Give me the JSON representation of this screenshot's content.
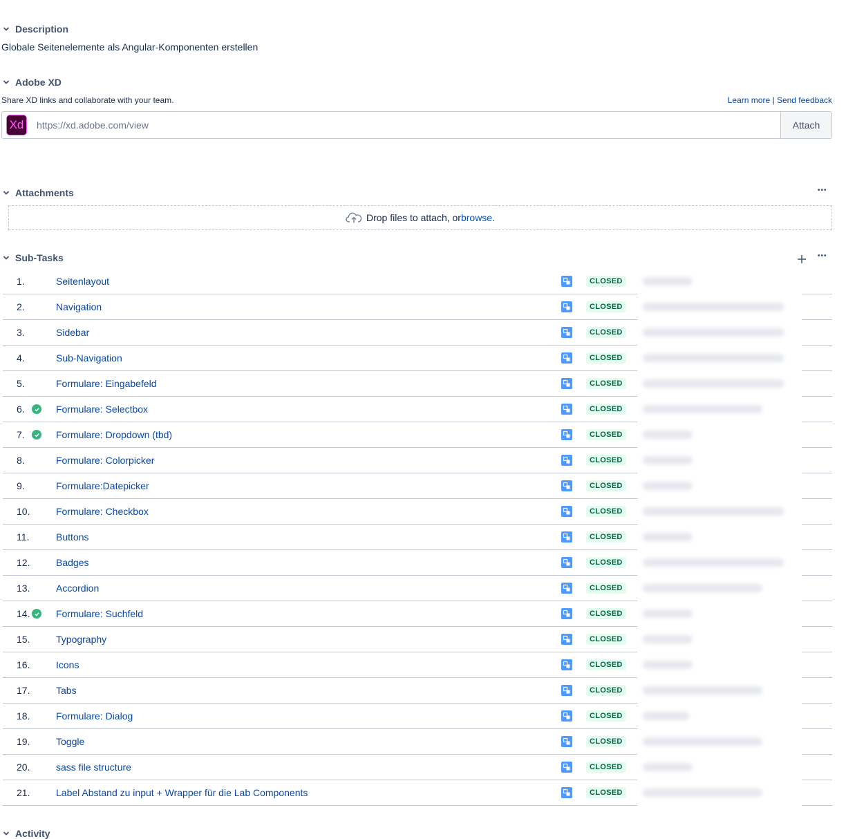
{
  "description": {
    "title": "Description",
    "text": "Globale Seitenelemente als Angular-Komponenten erstellen"
  },
  "adobe_xd": {
    "title": "Adobe XD",
    "note": "Share XD links and collaborate with your team.",
    "learn_more": "Learn more",
    "separator": "|",
    "send_feedback": "Send feedback",
    "logo_text": "Xd",
    "placeholder": "https://xd.adobe.com/view",
    "attach_label": "Attach"
  },
  "attachments": {
    "title": "Attachments",
    "more": "•••",
    "drop_text": "Drop files to attach, or ",
    "browse": "browse",
    "drop_suffix": "."
  },
  "subtasks": {
    "title": "Sub-Tasks",
    "more": "•••",
    "items": [
      {
        "num": "1.",
        "summary": "Seitenlayout",
        "status": "CLOSED",
        "check": false,
        "assignee_width": 0.3
      },
      {
        "num": "2.",
        "summary": "Navigation",
        "status": "CLOSED",
        "check": false,
        "assignee_width": 0.85
      },
      {
        "num": "3.",
        "summary": "Sidebar",
        "status": "CLOSED",
        "check": false,
        "assignee_width": 0.85
      },
      {
        "num": "4.",
        "summary": "Sub-Navigation",
        "status": "CLOSED",
        "check": false,
        "assignee_width": 0.85
      },
      {
        "num": "5.",
        "summary": "Formulare: Eingabefeld",
        "status": "CLOSED",
        "check": false,
        "assignee_width": 0.85
      },
      {
        "num": "6.",
        "summary": "Formulare: Selectbox",
        "status": "CLOSED",
        "check": true,
        "assignee_width": 0.72
      },
      {
        "num": "7.",
        "summary": "Formulare: Dropdown (tbd)",
        "status": "CLOSED",
        "check": true,
        "assignee_width": 0.3
      },
      {
        "num": "8.",
        "summary": "Formulare: Colorpicker",
        "status": "CLOSED",
        "check": false,
        "assignee_width": 0.3
      },
      {
        "num": "9.",
        "summary": "Formulare:Datepicker",
        "status": "CLOSED",
        "check": false,
        "assignee_width": 0.3
      },
      {
        "num": "10.",
        "summary": "Formulare: Checkbox",
        "status": "CLOSED",
        "check": false,
        "assignee_width": 0.85
      },
      {
        "num": "11.",
        "summary": "Buttons",
        "status": "CLOSED",
        "check": false,
        "assignee_width": 0.3
      },
      {
        "num": "12.",
        "summary": "Badges",
        "status": "CLOSED",
        "check": false,
        "assignee_width": 0.85
      },
      {
        "num": "13.",
        "summary": "Accordion",
        "status": "CLOSED",
        "check": false,
        "assignee_width": 0.72
      },
      {
        "num": "14.",
        "summary": "Formulare: Suchfeld",
        "status": "CLOSED",
        "check": true,
        "assignee_width": 0.3
      },
      {
        "num": "15.",
        "summary": "Typography",
        "status": "CLOSED",
        "check": false,
        "assignee_width": 0.3
      },
      {
        "num": "16.",
        "summary": "Icons",
        "status": "CLOSED",
        "check": false,
        "assignee_width": 0.3
      },
      {
        "num": "17.",
        "summary": "Tabs",
        "status": "CLOSED",
        "check": false,
        "assignee_width": 0.72
      },
      {
        "num": "18.",
        "summary": "Formulare: Dialog",
        "status": "CLOSED",
        "check": false,
        "assignee_width": 0.28
      },
      {
        "num": "19.",
        "summary": "Toggle",
        "status": "CLOSED",
        "check": false,
        "assignee_width": 0.72
      },
      {
        "num": "20.",
        "summary": "sass file structure",
        "status": "CLOSED",
        "check": false,
        "assignee_width": 0.3
      },
      {
        "num": "21.",
        "summary": "Label Abstand zu input + Wrapper für die Lab Components",
        "status": "CLOSED",
        "check": false,
        "assignee_width": 0.72
      }
    ]
  },
  "activity": {
    "title": "Activity"
  },
  "colors": {
    "link": "#0747a6",
    "status_bg": "#e3fcef",
    "status_text": "#006644",
    "check_green": "#36b37e",
    "subtask_icon": "#4c9aff"
  }
}
